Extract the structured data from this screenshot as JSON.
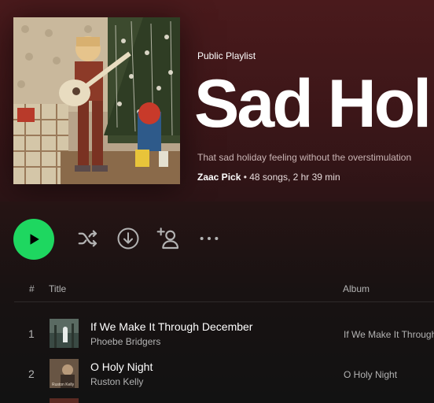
{
  "playlist": {
    "type_label": "Public Playlist",
    "title": "Sad Holi",
    "description": "That sad holiday feeling without the overstimulation",
    "owner": "Zaac Pick",
    "stats": " • 48 songs, 2 hr 39 min"
  },
  "actions": {
    "play_icon": "play-icon",
    "shuffle_icon": "shuffle-icon",
    "download_icon": "download-icon",
    "add_user_icon": "add-user-icon",
    "more_icon": "more-options-icon",
    "accent_color": "#1ed760"
  },
  "tracklist": {
    "columns": {
      "number": "#",
      "title": "Title",
      "album": "Album"
    },
    "tracks": [
      {
        "number": "1",
        "title": "If We Make It Through December",
        "artist": "Phoebe Bridgers",
        "album": "If We Make It Through December"
      },
      {
        "number": "2",
        "title": "O Holy Night",
        "artist": "Ruston Kelly",
        "album": "O Holy Night",
        "cover_text": "Ruston Kelly"
      }
    ]
  }
}
